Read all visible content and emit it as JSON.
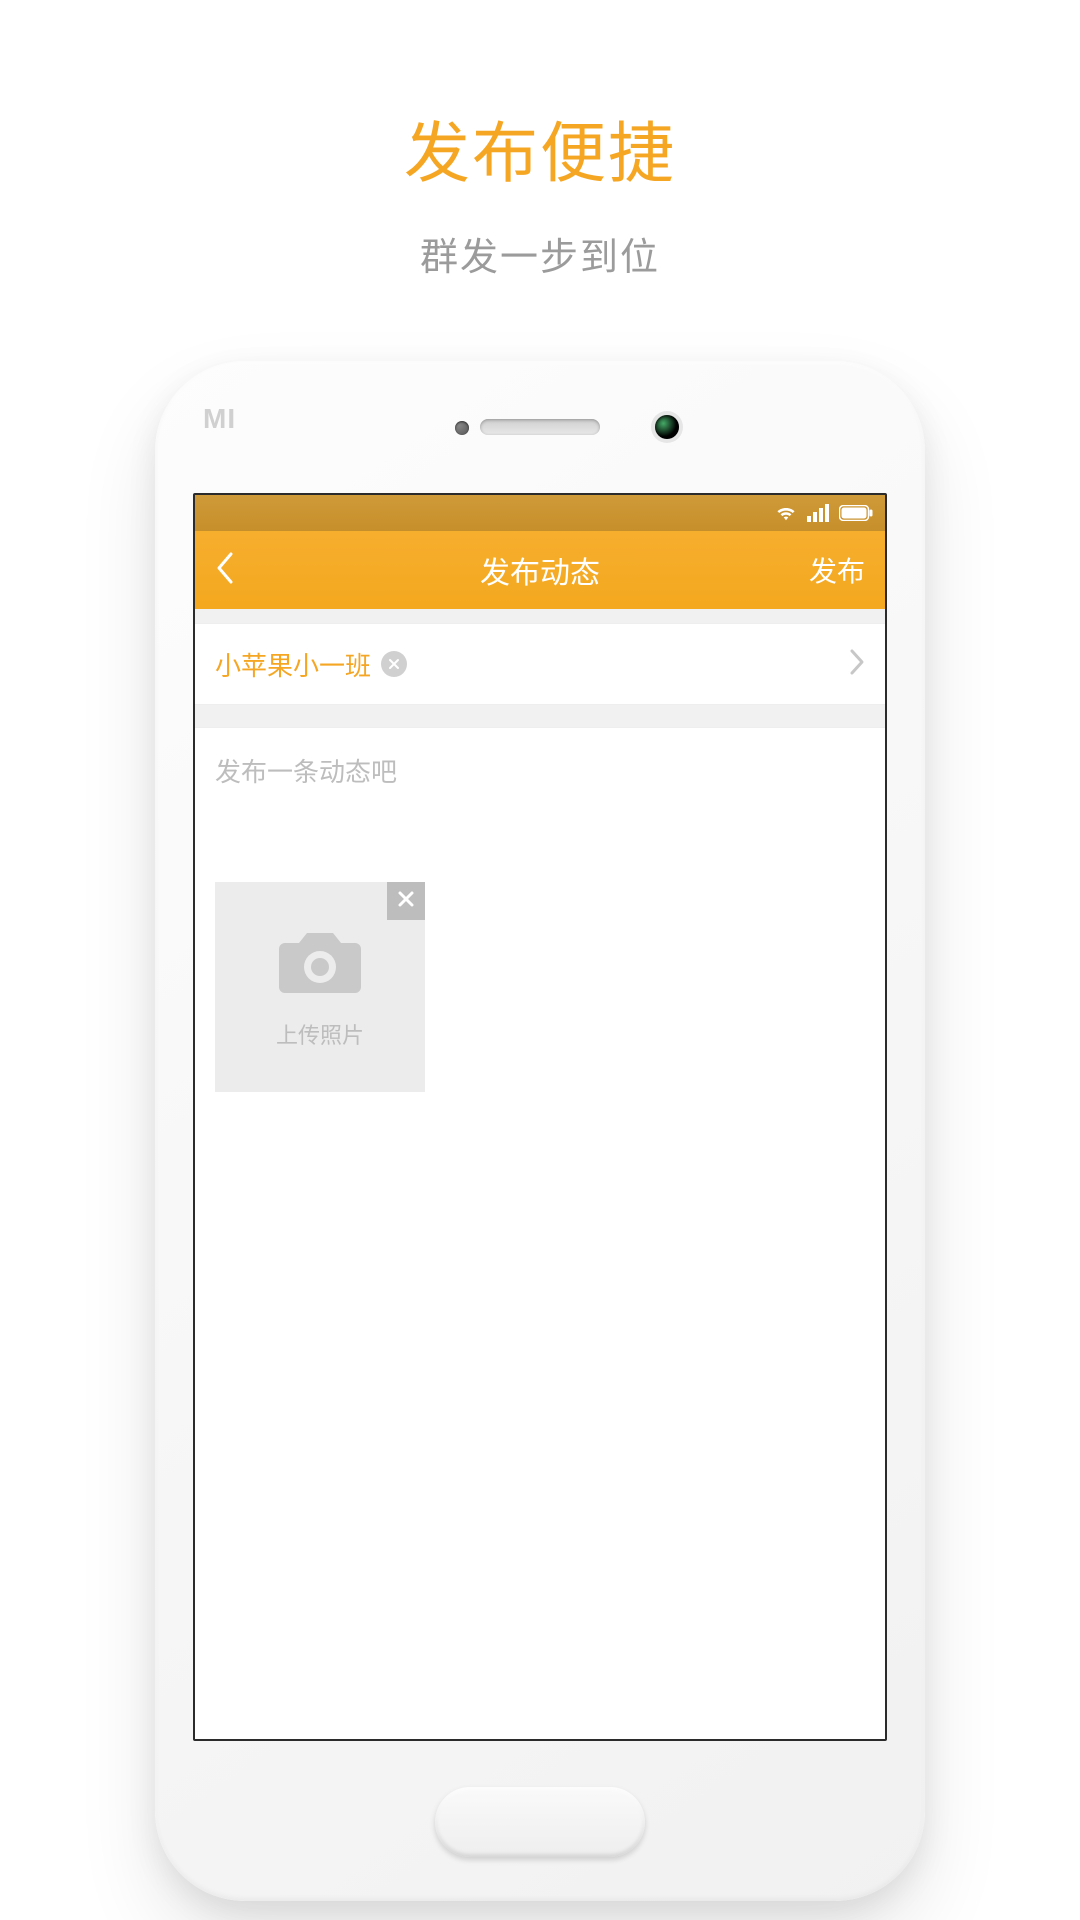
{
  "hero": {
    "title": "发布便捷",
    "subtitle": "群发一步到位"
  },
  "device": {
    "logo": "MI"
  },
  "nav": {
    "title": "发布动态",
    "publish": "发布"
  },
  "class_selector": {
    "selected": "小苹果小一班"
  },
  "compose": {
    "placeholder": "发布一条动态吧"
  },
  "upload": {
    "label": "上传照片"
  },
  "colors": {
    "accent": "#f5a623"
  }
}
